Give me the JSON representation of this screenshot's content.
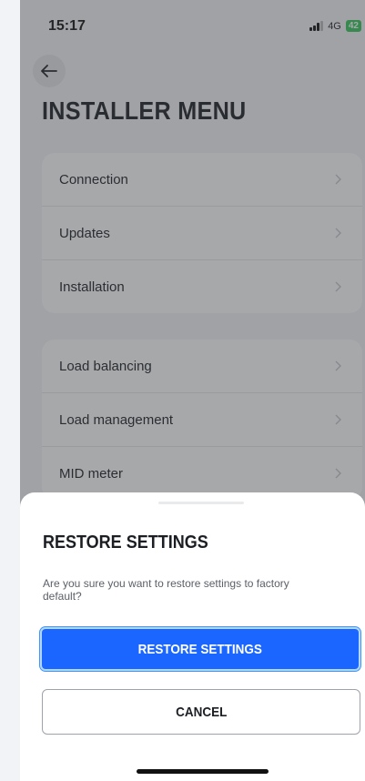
{
  "status_bar": {
    "time": "15:17",
    "network": "4G",
    "battery": "42"
  },
  "page": {
    "title": "INSTALLER MENU",
    "back_icon": "arrow-left-icon"
  },
  "menu_groups": [
    {
      "items": [
        {
          "label": "Connection"
        },
        {
          "label": "Updates"
        },
        {
          "label": "Installation"
        }
      ]
    },
    {
      "items": [
        {
          "label": "Load balancing"
        },
        {
          "label": "Load management"
        },
        {
          "label": "MID meter"
        }
      ]
    }
  ],
  "dialog": {
    "title": "RESTORE SETTINGS",
    "message": "Are you sure you want to restore settings to factory default?",
    "confirm_label": "RESTORE SETTINGS",
    "cancel_label": "CANCEL"
  },
  "colors": {
    "primary": "#1a66ff",
    "battery": "#34c759"
  }
}
